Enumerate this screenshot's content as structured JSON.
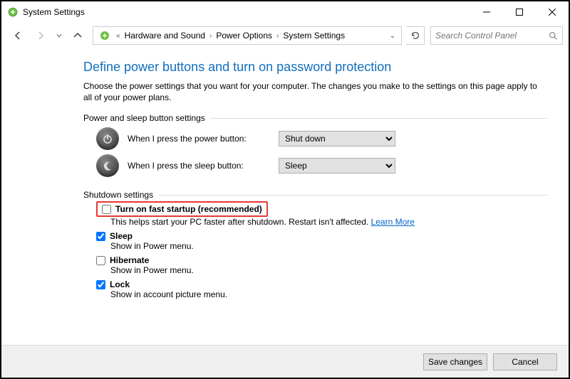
{
  "titlebar": {
    "title": "System Settings"
  },
  "breadcrumbs": {
    "items": [
      "Hardware and Sound",
      "Power Options",
      "System Settings"
    ]
  },
  "search": {
    "placeholder": "Search Control Panel"
  },
  "page": {
    "title": "Define power buttons and turn on password protection",
    "desc": "Choose the power settings that you want for your computer. The changes you make to the settings on this page apply to all of your power plans."
  },
  "section1": {
    "title": "Power and sleep button settings",
    "row1_label": "When I press the power button:",
    "row1_selected": "Shut down",
    "row2_label": "When I press the sleep button:",
    "row2_selected": "Sleep"
  },
  "section2": {
    "title": "Shutdown settings",
    "items": [
      {
        "label": "Turn on fast startup (recommended)",
        "checked": false,
        "desc": "This helps start your PC faster after shutdown. Restart isn't affected.",
        "learn_more": "Learn More",
        "highlighted": true
      },
      {
        "label": "Sleep",
        "checked": true,
        "desc": "Show in Power menu."
      },
      {
        "label": "Hibernate",
        "checked": false,
        "desc": "Show in Power menu."
      },
      {
        "label": "Lock",
        "checked": true,
        "desc": "Show in account picture menu."
      }
    ]
  },
  "footer": {
    "save": "Save changes",
    "cancel": "Cancel"
  }
}
